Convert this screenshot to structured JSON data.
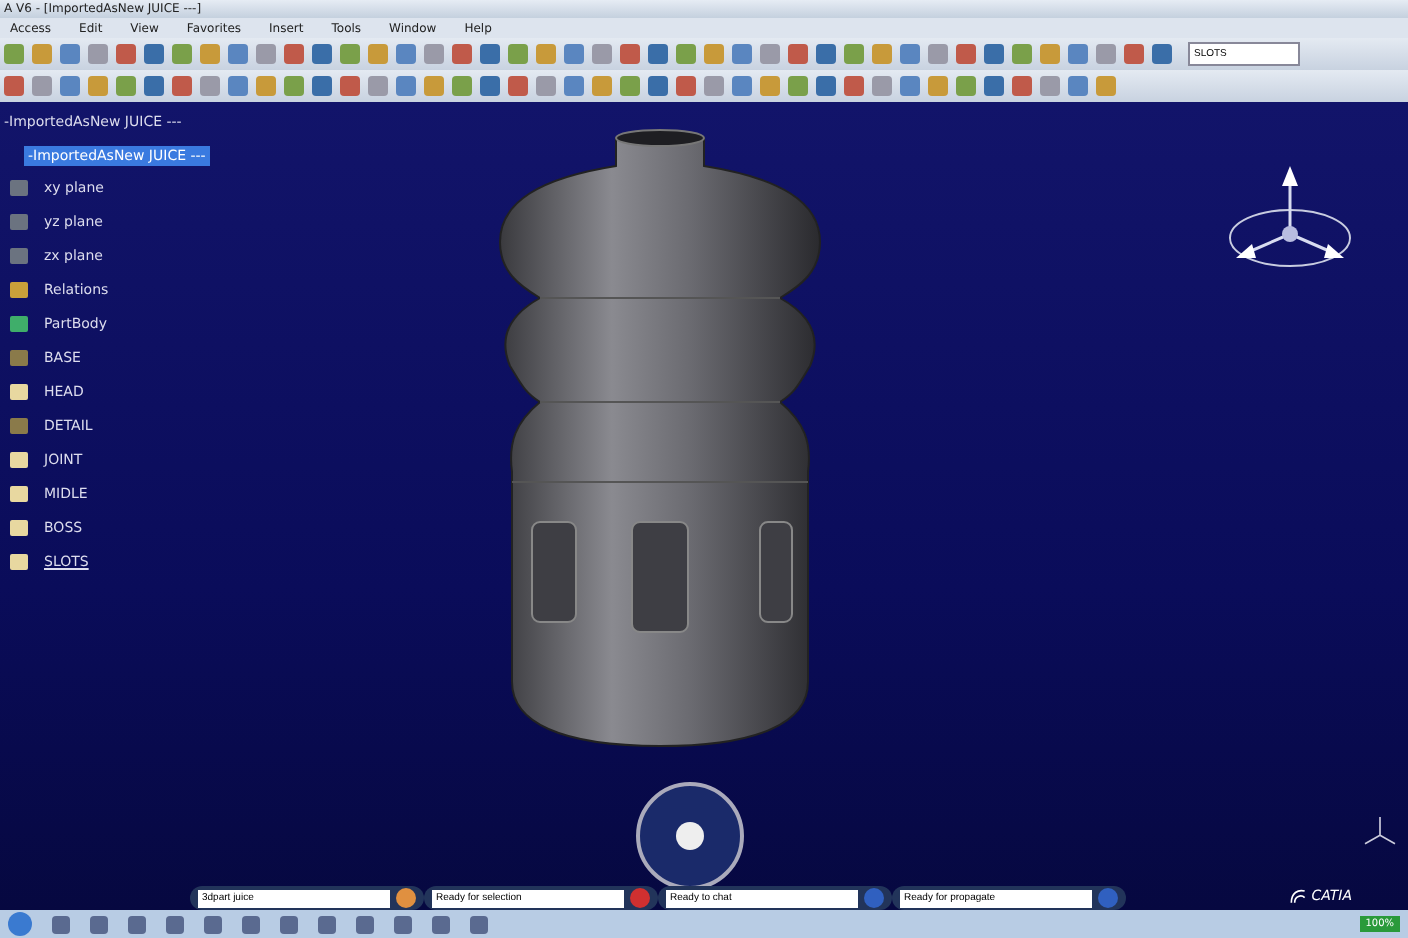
{
  "window": {
    "title": "A V6 - [ImportedAsNew JUICE ---]"
  },
  "menu": [
    "Access",
    "Edit",
    "View",
    "Favorites",
    "Insert",
    "Tools",
    "Window",
    "Help"
  ],
  "toolbar": {
    "search": {
      "value": "SLOTS"
    }
  },
  "tree": {
    "header": "-ImportedAsNew JUICE ---",
    "root": {
      "label": "-ImportedAsNew JUICE ---",
      "selected": true
    },
    "children": [
      {
        "label": "xy plane",
        "kind": "plane",
        "current": false
      },
      {
        "label": "yz plane",
        "kind": "plane",
        "current": false
      },
      {
        "label": "zx plane",
        "kind": "plane",
        "current": false
      },
      {
        "label": "Relations",
        "kind": "relations",
        "current": false
      },
      {
        "label": "PartBody",
        "kind": "partbody",
        "current": false
      },
      {
        "label": "BASE",
        "kind": "geoset",
        "current": false
      },
      {
        "label": "HEAD",
        "kind": "feature",
        "current": false
      },
      {
        "label": "DETAIL",
        "kind": "geoset",
        "current": false
      },
      {
        "label": "JOINT",
        "kind": "feature",
        "current": false
      },
      {
        "label": "MIDLE",
        "kind": "feature",
        "current": false
      },
      {
        "label": "BOSS",
        "kind": "feature",
        "current": false
      },
      {
        "label": "SLOTS",
        "kind": "feature",
        "current": true
      }
    ]
  },
  "status_fields": [
    {
      "value": "3dpart juice"
    },
    {
      "value": "Ready for selection"
    },
    {
      "value": "Ready to chat"
    },
    {
      "value": "Ready for propagate"
    }
  ],
  "logo": "CATIA",
  "taskbar": {
    "battery": "100%"
  }
}
